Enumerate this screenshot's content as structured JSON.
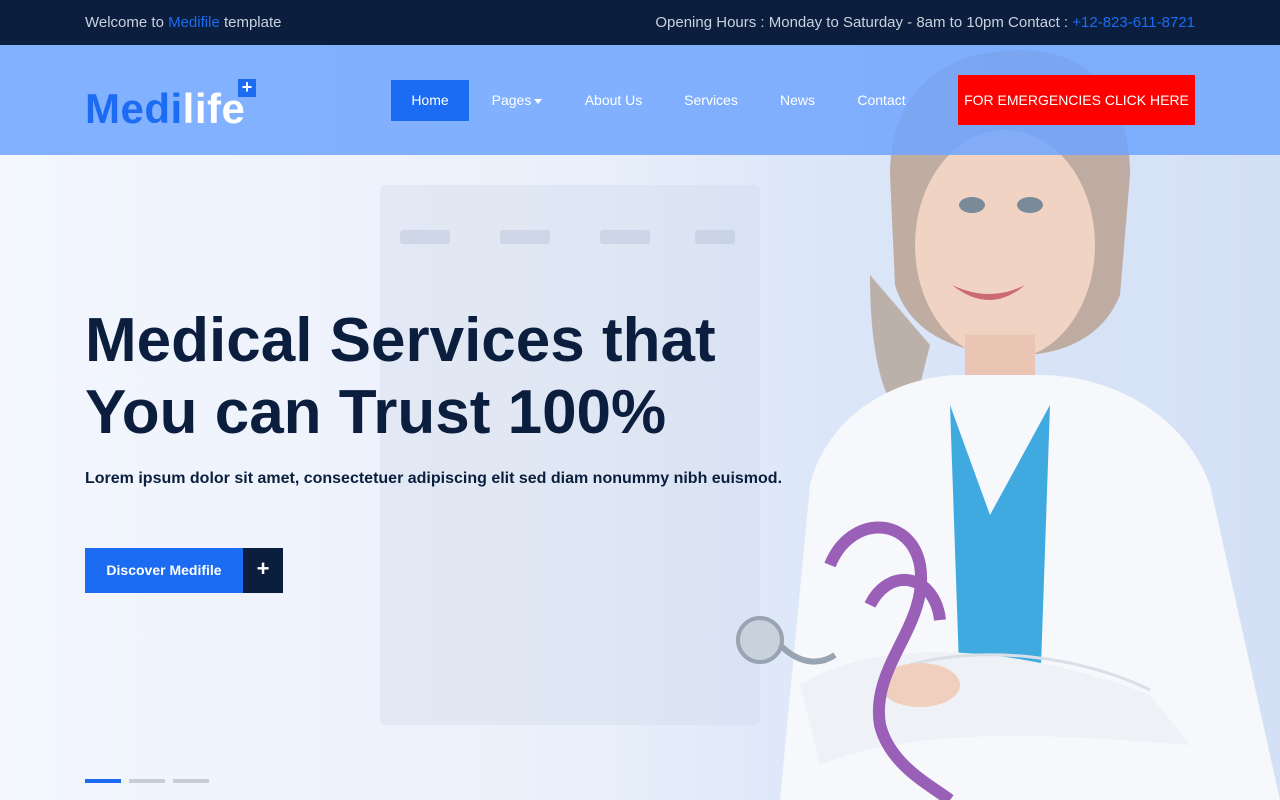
{
  "topbar": {
    "welcome_prefix": "Welcome to ",
    "welcome_brand": "Medifile",
    "welcome_suffix": " template",
    "hours_text": "Opening Hours : Monday to Saturday - 8am to 10pm Contact : ",
    "phone": "+12-823-611-8721"
  },
  "header": {
    "logo_part1": "Medi",
    "logo_part2": "life",
    "logo_plus": "+",
    "nav": [
      {
        "label": "Home",
        "active": true
      },
      {
        "label": "Pages",
        "dropdown": true
      },
      {
        "label": "About Us"
      },
      {
        "label": "Services"
      },
      {
        "label": "News"
      },
      {
        "label": "Contact"
      }
    ],
    "emergency_label": "FOR EMERGENCIES CLICK HERE"
  },
  "hero": {
    "headline_line1": "Medical Services that",
    "headline_line2": "You can Trust 100%",
    "subline": "Lorem ipsum dolor sit amet, consectetuer adipiscing elit sed diam nonummy nibh euismod.",
    "cta_label": "Discover Medifile",
    "cta_plus": "+",
    "slides": 3,
    "active_slide": 1
  },
  "colors": {
    "primary": "#1b6cf2",
    "dark": "#0b1e3d",
    "emergency": "#ff0000"
  },
  "icons": [
    "plus-icon",
    "chevron-down-icon"
  ]
}
